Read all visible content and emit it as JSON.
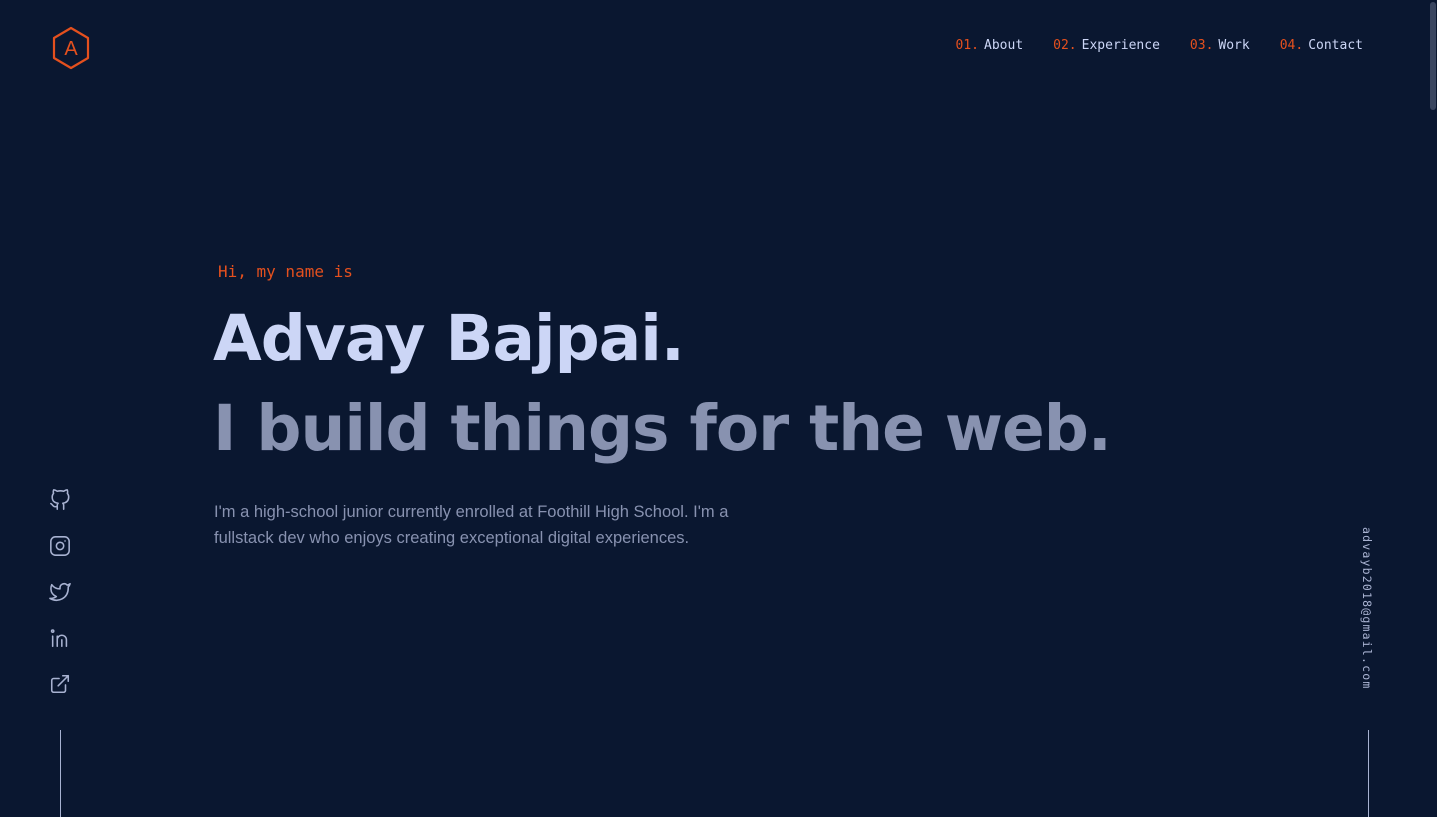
{
  "logo": {
    "letter": "A",
    "icon": "hexagon-logo-icon"
  },
  "nav": {
    "items": [
      {
        "num": "01.",
        "label": "About"
      },
      {
        "num": "02.",
        "label": "Experience"
      },
      {
        "num": "03.",
        "label": "Work"
      },
      {
        "num": "04.",
        "label": "Contact"
      }
    ]
  },
  "hero": {
    "intro": "Hi, my name is",
    "name": "Advay Bajpai.",
    "tagline": "I build things for the web.",
    "bio": "I'm a high-school junior currently enrolled at Foothill High School. I'm a fullstack dev who enjoys creating exceptional digital experiences."
  },
  "socials": [
    {
      "icon": "github-icon"
    },
    {
      "icon": "instagram-icon"
    },
    {
      "icon": "twitter-icon"
    },
    {
      "icon": "linkedin-icon"
    },
    {
      "icon": "external-link-icon"
    }
  ],
  "email": "advayb2018@gmail.com",
  "colors": {
    "background": "#0a1730",
    "accent": "#e4501e",
    "heading": "#ccd6f6",
    "muted": "#8892b0"
  }
}
